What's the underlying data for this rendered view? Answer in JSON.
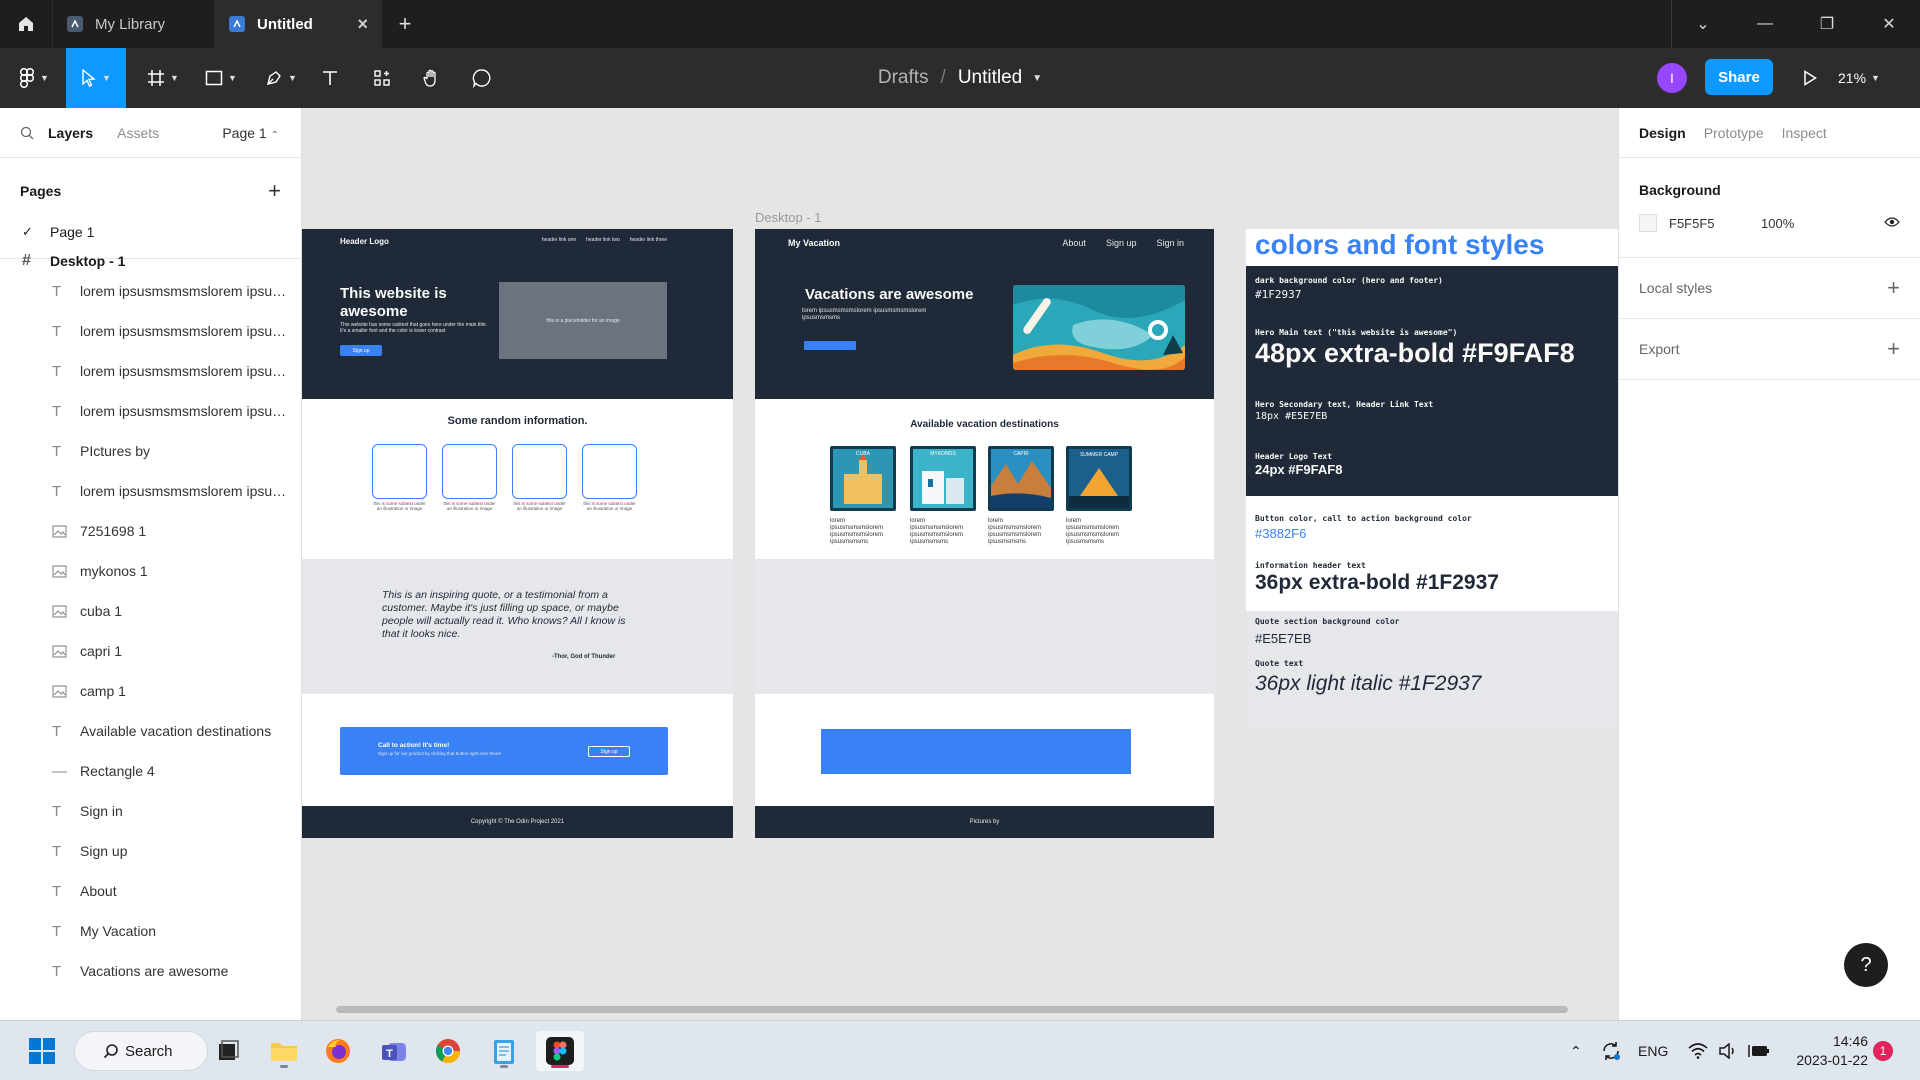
{
  "titlebar": {
    "tabs": [
      {
        "label": "My Library"
      },
      {
        "label": "Untitled"
      }
    ],
    "new_tab": "+"
  },
  "toolbar": {
    "breadcrumb_parent": "Drafts",
    "breadcrumb_sep": "/",
    "file_name": "Untitled",
    "avatar_initial": "I",
    "share_label": "Share",
    "zoom": "21%"
  },
  "left_panel": {
    "tabs": {
      "layers": "Layers",
      "assets": "Assets",
      "page_selector": "Page 1"
    },
    "pages_header": "Pages",
    "pages": [
      "Page 1"
    ],
    "frame_layer": "Desktop - 1",
    "layers": [
      {
        "type": "text",
        "name": "lorem ipsusmsmsmslorem ipsusmsmsmslorem ipsusmsmsms"
      },
      {
        "type": "text",
        "name": "lorem ipsusmsmsmslorem ipsusmsmsmslorem ipsusmsmsms"
      },
      {
        "type": "text",
        "name": "lorem ipsusmsmsmslorem ipsusmsmsmslorem ipsusmsmsms"
      },
      {
        "type": "text",
        "name": "lorem ipsusmsmsmslorem ipsusmsmsmslorem ipsusmsmsms"
      },
      {
        "type": "text",
        "name": "PIctures by"
      },
      {
        "type": "text",
        "name": "lorem ipsusmsmsmslorem ipsusmsmsmslorem ipsusmsmsms"
      },
      {
        "type": "image",
        "name": "7251698 1"
      },
      {
        "type": "image",
        "name": "mykonos 1"
      },
      {
        "type": "image",
        "name": "cuba 1"
      },
      {
        "type": "image",
        "name": "capri 1"
      },
      {
        "type": "image",
        "name": "camp 1"
      },
      {
        "type": "text",
        "name": "Available vacation destinations"
      },
      {
        "type": "rect",
        "name": "Rectangle 4"
      },
      {
        "type": "text",
        "name": "Sign in"
      },
      {
        "type": "text",
        "name": "Sign up"
      },
      {
        "type": "text",
        "name": "About"
      },
      {
        "type": "text",
        "name": "My Vacation"
      },
      {
        "type": "text",
        "name": "Vacations are awesome"
      }
    ]
  },
  "canvas": {
    "frame_label": "Desktop - 1",
    "mock1": {
      "logo": "Header Logo",
      "links": [
        "header link one",
        "header link two",
        "header link three"
      ],
      "hero_title": "This website is awesome",
      "hero_sub": "This website has some subtext that goes here under the main title. It's a smaller font and the color is lower contrast",
      "hero_button": "Sign up",
      "image_placeholder": "this is a placeholder for an image",
      "info_title": "Some random information.",
      "card_caption": "this is some subtext under an illustration or image",
      "quote": "This is an inspiring quote, or a testimonial from a customer.  Maybe it's just filling up space, or maybe people will actually read it. Who knows?  All I know is that it looks nice.",
      "quote_author": "-Thor, God of Thunder",
      "cta_title": "Call to action! It's time!",
      "cta_sub": "Sign up for our product by clicking that button right over there!",
      "cta_button": "Sign up",
      "footer": "Copyright © The Odin Project 2021"
    },
    "mock2": {
      "logo": "My Vacation",
      "nav": [
        "About",
        "Sign up",
        "Sign in"
      ],
      "hero_title": "Vacations are awesome",
      "hero_sub": "lorem ipsusmsmsmslorem ipsusmsmsmslorem ipsusmsmsms",
      "dest_title": "Available vacation destinations",
      "destinations": [
        "CUBA",
        "MYKONOS",
        "CAPRI",
        "SUMMER CAMP"
      ],
      "card_caption": "lorem ipsusmsmsmslorem ipsusmsmsmslorem ipsusmsmsms",
      "footer": "Pictures by"
    },
    "styleguide": {
      "heading": "colors and font styles",
      "dark_bg_label": "dark background color (hero and footer)",
      "dark_bg_value": "#1F2937",
      "hero_main_label": "Hero Main text (\"this website is awesome\")",
      "hero_main_value": "48px extra-bold #F9FAF8",
      "hero_secondary_label": "Hero Secondary text, Header Link Text",
      "hero_secondary_value": "18px #E5E7EB",
      "header_logo_label": "Header Logo Text",
      "header_logo_value": "24px #F9FAF8",
      "button_label": "Button color, call to action background color",
      "button_value": "#3882F6",
      "info_header_label": "information header text",
      "info_header_value": "36px extra-bold #1F2937",
      "quote_bg_label": "Quote section background color",
      "quote_bg_value": "#E5E7EB",
      "quote_text_label": "Quote text",
      "quote_text_value": "36px light italic #1F2937"
    }
  },
  "right_panel": {
    "tabs": [
      "Design",
      "Prototype",
      "Inspect"
    ],
    "background_title": "Background",
    "background_hex": "F5F5F5",
    "background_opacity": "100%",
    "local_styles": "Local styles",
    "export": "Export",
    "help": "?"
  },
  "taskbar": {
    "search_label": "Search",
    "language": "ENG",
    "time": "14:46",
    "date": "2023-01-22",
    "notifications": "1"
  },
  "colors": {
    "figma_blue": "#0d99ff",
    "dark": "#1f2937",
    "accent": "#3882f6",
    "quote_bg": "#e5e7eb"
  }
}
